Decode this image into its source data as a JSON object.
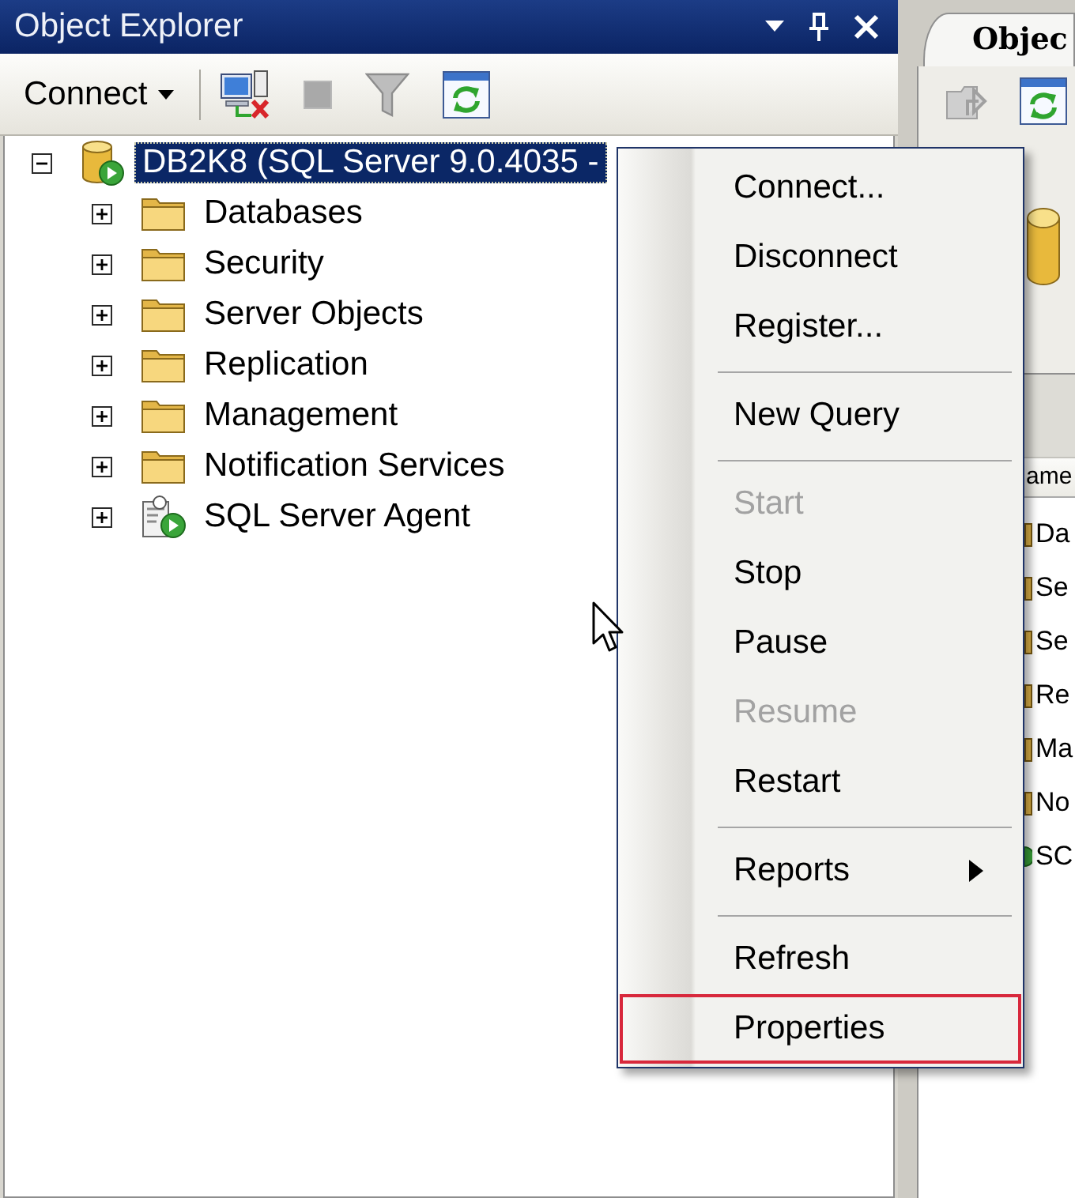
{
  "object_explorer": {
    "title": "Object Explorer",
    "toolbar": {
      "connect_label": "Connect",
      "buttons": [
        {
          "kind": "disconnect",
          "disabled": false
        },
        {
          "kind": "stop",
          "disabled": true
        },
        {
          "kind": "filter",
          "disabled": true
        },
        {
          "kind": "refresh",
          "disabled": false
        }
      ]
    },
    "tree": [
      {
        "label": "DB2K8 (SQL Server 9.0.4035 -",
        "kind": "server",
        "expanded": true,
        "selected": true,
        "children": [
          {
            "label": "Databases",
            "kind": "folder",
            "expanded": false,
            "selected": false
          },
          {
            "label": "Security",
            "kind": "folder",
            "expanded": false,
            "selected": false
          },
          {
            "label": "Server Objects",
            "kind": "folder",
            "expanded": false,
            "selected": false
          },
          {
            "label": "Replication",
            "kind": "folder",
            "expanded": false,
            "selected": false
          },
          {
            "label": "Management",
            "kind": "folder",
            "expanded": false,
            "selected": false
          },
          {
            "label": "Notification Services",
            "kind": "folder",
            "expanded": false,
            "selected": false
          },
          {
            "label": "SQL Server Agent",
            "kind": "agent",
            "expanded": false,
            "selected": false
          }
        ]
      }
    ]
  },
  "details_pane": {
    "tab": {
      "label": "Objec",
      "selected": true
    },
    "toolbar": {
      "buttons": [
        {
          "kind": "up",
          "disabled": true
        },
        {
          "kind": "refresh",
          "disabled": false
        }
      ]
    },
    "list": {
      "header": "ame",
      "rows": [
        {
          "label": "Da",
          "kind": "folder"
        },
        {
          "label": "Se",
          "kind": "folder"
        },
        {
          "label": "Se",
          "kind": "folder"
        },
        {
          "label": "Re",
          "kind": "folder"
        },
        {
          "label": "Ma",
          "kind": "folder"
        },
        {
          "label": "No",
          "kind": "folder"
        },
        {
          "label": "SC",
          "kind": "agent"
        }
      ]
    }
  },
  "context_menu": {
    "items": [
      {
        "label": "Connect...",
        "disabled": false,
        "separator_before": false,
        "submenu": false,
        "highlighted": false
      },
      {
        "label": "Disconnect",
        "disabled": false,
        "separator_before": false,
        "submenu": false,
        "highlighted": false
      },
      {
        "label": "Register...",
        "disabled": false,
        "separator_before": false,
        "submenu": false,
        "highlighted": false
      },
      {
        "label": "New Query",
        "disabled": false,
        "separator_before": true,
        "submenu": false,
        "highlighted": false
      },
      {
        "label": "Start",
        "disabled": true,
        "separator_before": true,
        "submenu": false,
        "highlighted": false
      },
      {
        "label": "Stop",
        "disabled": false,
        "separator_before": false,
        "submenu": false,
        "highlighted": false
      },
      {
        "label": "Pause",
        "disabled": false,
        "separator_before": false,
        "submenu": false,
        "highlighted": false
      },
      {
        "label": "Resume",
        "disabled": true,
        "separator_before": false,
        "submenu": false,
        "highlighted": false
      },
      {
        "label": "Restart",
        "disabled": false,
        "separator_before": false,
        "submenu": false,
        "highlighted": false
      },
      {
        "label": "Reports",
        "disabled": false,
        "separator_before": true,
        "submenu": true,
        "highlighted": false
      },
      {
        "label": "Refresh",
        "disabled": false,
        "separator_before": true,
        "submenu": false,
        "highlighted": false
      },
      {
        "label": "Properties",
        "disabled": false,
        "separator_before": false,
        "submenu": false,
        "highlighted": true
      }
    ]
  }
}
